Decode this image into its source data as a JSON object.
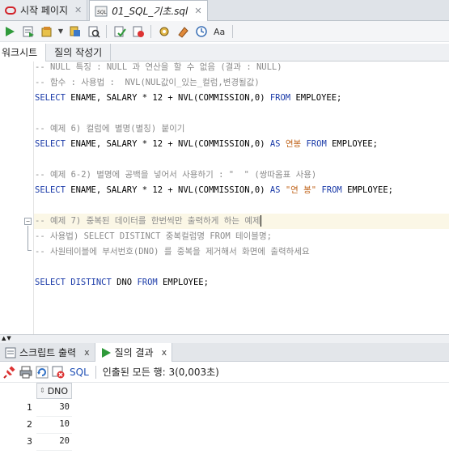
{
  "tabs": [
    {
      "label": "시작 페이지",
      "active": false
    },
    {
      "label": "01_SQL_기초.sql",
      "active": true
    }
  ],
  "sub_tabs": {
    "worksheet": "워크시트",
    "query_builder": "질의 작성기"
  },
  "editor": {
    "lines": [
      {
        "text": "-- NULL 특징 : NULL 과 연산을 할 수 없음 (결과 : NULL)"
      },
      {
        "text": "-- 함수 : 사용법 :  NVL(NUL값이_있는_컬럼,변경될값)"
      },
      {
        "text": "SELECT ENAME, SALARY * 12 + NVL(COMMISSION,0) FROM EMPLOYEE;"
      },
      {
        "text": "-- 예제 6) 컬럼에 별명(별칭) 붙이기"
      },
      {
        "text": "SELECT ENAME, SALARY * 12 + NVL(COMMISSION,0) AS 연봉 FROM EMPLOYEE;"
      },
      {
        "text": "-- 예제 6-2) 별명에 공백을 넣어서 사용하기 : \"  \" (쌍따옴표 사용)"
      },
      {
        "text": "SELECT ENAME, SALARY * 12 + NVL(COMMISSION,0) AS \"연 봉\" FROM EMPLOYEE;"
      },
      {
        "text": "-- 예제 7) 중복된 데이터를 한번씩만 출력하게 하는 예제"
      },
      {
        "text": "-- 사용법) SELECT DISTINCT 중복컬럼명 FROM 테이블명;"
      },
      {
        "text": "-- 사원테이블에 부서번호(DNO) 를 중복을 제거해서 화면에 출력하세요"
      },
      {
        "text": "SELECT DISTINCT DNO FROM EMPLOYEE;"
      }
    ]
  },
  "bottom_tabs": [
    {
      "label": "스크립트 출력",
      "close": "x"
    },
    {
      "label": "질의 결과",
      "close": "x"
    }
  ],
  "result": {
    "sql_label": "SQL",
    "status": "인출된 모든 행: 3(0,003초)",
    "column": "DNO",
    "rows": [
      {
        "num": "1",
        "value": "30"
      },
      {
        "num": "2",
        "value": "10"
      },
      {
        "num": "3",
        "value": "20"
      }
    ]
  },
  "icons": [
    "oracle-icon",
    "sql-file-icon",
    "run-statement-icon",
    "run-script-icon",
    "commit-icon",
    "rollback-icon",
    "explain-plan-icon",
    "autotrace-icon",
    "clear-icon",
    "history-icon",
    "format-icon",
    "pin-icon",
    "print-icon",
    "refresh-icon",
    "cancel-query-icon"
  ],
  "colors": {
    "keyword": "#1a3aa8",
    "comment": "#8a8a8a",
    "string": "#c0641b",
    "highlight_line": "#fbf7e6"
  }
}
